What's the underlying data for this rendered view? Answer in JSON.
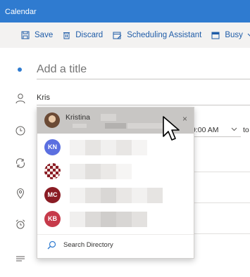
{
  "titlebar": {
    "title": "Calendar"
  },
  "toolbar": {
    "save_label": "Save",
    "discard_label": "Discard",
    "scheduling_label": "Scheduling Assistant",
    "busy_label": "Busy"
  },
  "form": {
    "title_placeholder": "Add a title",
    "people_value": "Kris",
    "start_time": "9:00 AM",
    "to_label": "to"
  },
  "dropdown": {
    "top_suggestion": {
      "name": "Kristina",
      "close": "×"
    },
    "people": [
      {
        "initials": "KN",
        "color": "#5b6fe0"
      },
      {
        "initials": "",
        "color": "#8a1c24"
      },
      {
        "initials": "MC",
        "color": "#8a1c24"
      },
      {
        "initials": "KB",
        "color": "#c63a4a"
      }
    ],
    "search_directory_label": "Search Directory"
  },
  "icons": [
    "save-icon",
    "discard-icon",
    "scheduling-icon",
    "calendar-busy-icon",
    "person-icon",
    "clock-icon",
    "repeat-icon",
    "location-icon",
    "alarm-icon",
    "body-text-icon",
    "search-icon",
    "pointer-cursor-icon"
  ],
  "colors": {
    "accent": "#2f7bd0",
    "toolbar_text": "#1f5ca8"
  }
}
